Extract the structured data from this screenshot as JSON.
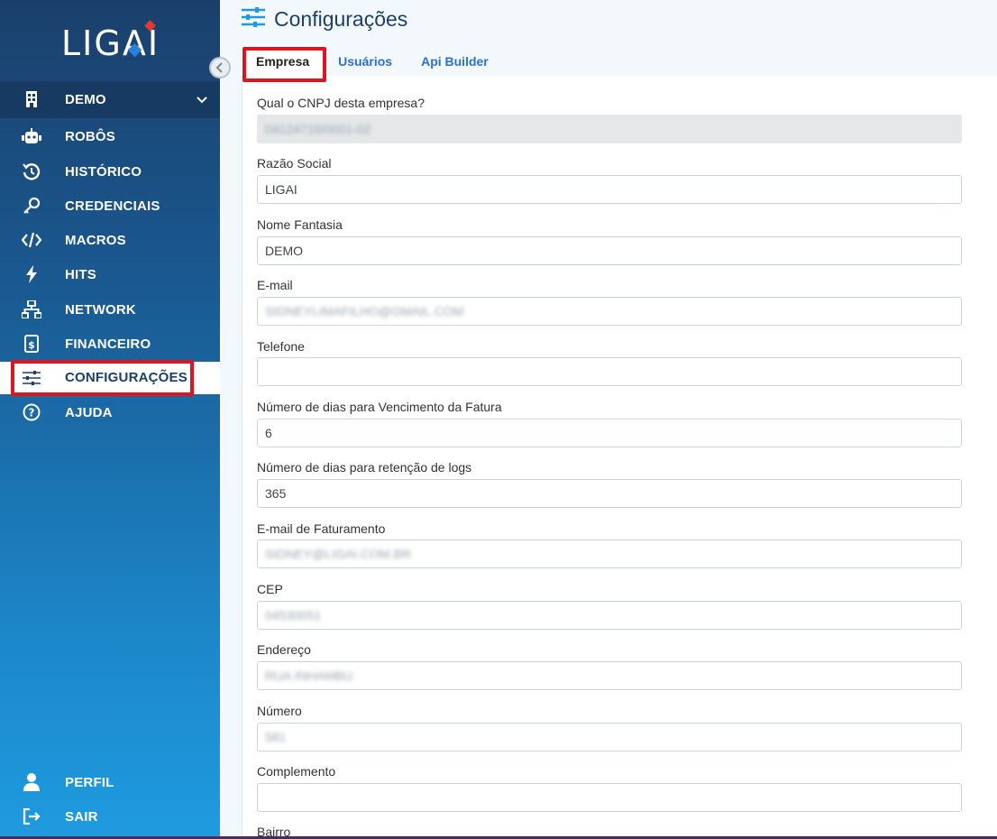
{
  "app": {
    "logo_text": "LIGAI"
  },
  "sidebar": {
    "org": {
      "label": "DEMO"
    },
    "items": [
      {
        "label": "ROBÔS",
        "icon": "robot-icon"
      },
      {
        "label": "HISTÓRICO",
        "icon": "history-icon"
      },
      {
        "label": "CREDENCIAIS",
        "icon": "key-icon"
      },
      {
        "label": "MACROS",
        "icon": "code-icon"
      },
      {
        "label": "HITS",
        "icon": "bolt-icon"
      },
      {
        "label": "NETWORK",
        "icon": "network-icon"
      },
      {
        "label": "FINANCEIRO",
        "icon": "invoice-icon"
      },
      {
        "label": "CONFIGURAÇÕES",
        "icon": "sliders-icon",
        "active": true
      },
      {
        "label": "AJUDA",
        "icon": "help-icon"
      }
    ],
    "bottom": [
      {
        "label": "PERFIL",
        "icon": "user-icon"
      },
      {
        "label": "SAIR",
        "icon": "logout-icon"
      }
    ]
  },
  "page": {
    "title": "Configurações",
    "tabs": [
      {
        "label": "Empresa",
        "active": true
      },
      {
        "label": "Usuários"
      },
      {
        "label": "Api Builder"
      }
    ]
  },
  "form": {
    "fields": [
      {
        "label": "Qual o CNPJ desta empresa?",
        "value": "04124716/0001-02",
        "disabled": true,
        "blurred": true
      },
      {
        "label": "Razão Social",
        "value": "LIGAI"
      },
      {
        "label": "Nome Fantasia",
        "value": "DEMO"
      },
      {
        "label": "E-mail",
        "value": "SIDNEYLIMAFILHO@GMAIL.COM",
        "blurred": true
      },
      {
        "label": "Telefone",
        "value": ""
      },
      {
        "label": "Número de dias para Vencimento da Fatura",
        "value": "6"
      },
      {
        "label": "Número de dias para retenção de logs",
        "value": "365"
      },
      {
        "label": "E-mail de Faturamento",
        "value": "SIDNEY@LIGAI.COM.BR",
        "blurred": true
      },
      {
        "label": "CEP",
        "value": "04530051",
        "blurred": true
      },
      {
        "label": "Endereço",
        "value": "RUA INHAMBU",
        "blurred": true
      },
      {
        "label": "Número",
        "value": "581",
        "blurred": true
      },
      {
        "label": "Complemento",
        "value": ""
      },
      {
        "label": "Bairro",
        "value": ""
      }
    ]
  },
  "colors": {
    "accent": "#1c86c8",
    "highlight": "#e0141c",
    "title": "#1d3f6e",
    "tab_link": "#2c6fd0"
  }
}
